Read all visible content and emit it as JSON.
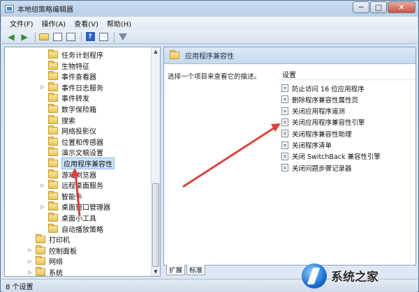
{
  "window": {
    "title": "本地组策略编辑器"
  },
  "window_buttons": {
    "minimize": "─",
    "maximize": "□",
    "close": "✕"
  },
  "menu": [
    "文件(F)",
    "操作(A)",
    "查看(V)",
    "帮助(H)"
  ],
  "toolbar": {
    "icons": [
      "back-arrow-icon",
      "forward-arrow-icon",
      "folder-up-icon",
      "show-hide-tree-icon",
      "export-list-icon",
      "help-icon",
      "properties-icon",
      "filter-icon"
    ]
  },
  "tree": {
    "items": [
      {
        "label": "任务计划程序",
        "expander": "",
        "level": 2
      },
      {
        "label": "生物特征",
        "expander": "",
        "level": 2
      },
      {
        "label": "事件查看器",
        "expander": "",
        "level": 2
      },
      {
        "label": "事件日志服务",
        "expander": "▷",
        "level": 2
      },
      {
        "label": "事件转发",
        "expander": "",
        "level": 2
      },
      {
        "label": "数字保险箱",
        "expander": "",
        "level": 2
      },
      {
        "label": "搜索",
        "expander": "",
        "level": 2
      },
      {
        "label": "网络投影仪",
        "expander": "",
        "level": 2
      },
      {
        "label": "位置和传感器",
        "expander": "",
        "level": 2
      },
      {
        "label": "演示文稿设置",
        "expander": "",
        "level": 2
      },
      {
        "label": "应用程序兼容性",
        "expander": "",
        "level": 2,
        "selected": true
      },
      {
        "label": "游戏浏览器",
        "expander": "",
        "level": 2
      },
      {
        "label": "远程桌面服务",
        "expander": "▷",
        "level": 2
      },
      {
        "label": "智能卡",
        "expander": "",
        "level": 2
      },
      {
        "label": "桌面窗口管理器",
        "expander": "▷",
        "level": 2
      },
      {
        "label": "桌面小工具",
        "expander": "",
        "level": 2
      },
      {
        "label": "自动播放策略",
        "expander": "",
        "level": 2
      },
      {
        "label": "打印机",
        "expander": "",
        "level": 1
      },
      {
        "label": "控制面板",
        "expander": "▷",
        "level": 1
      },
      {
        "label": "网络",
        "expander": "▷",
        "level": 1
      },
      {
        "label": "系统",
        "expander": "▷",
        "level": 1
      }
    ]
  },
  "right": {
    "title": "应用程序兼容性",
    "description": "选择一个项目来查看它的描述。",
    "column_header": "设置",
    "settings": [
      "防止访问 16 位应用程序",
      "删除程序兼容性属性页",
      "关闭应用程序遥测",
      "关闭应用程序兼容性引擎",
      "关闭程序兼容性助理",
      "关闭程序清单",
      "关闭 SwitchBack 兼容性引擎",
      "关闭问题步骤记录器"
    ]
  },
  "tabs": [
    "扩展",
    "标准"
  ],
  "status": "8 个设置",
  "watermark": {
    "text": "系统之家"
  },
  "colors": {
    "annotation_arrow": "#d8433a",
    "selection": "#cde5fb"
  }
}
